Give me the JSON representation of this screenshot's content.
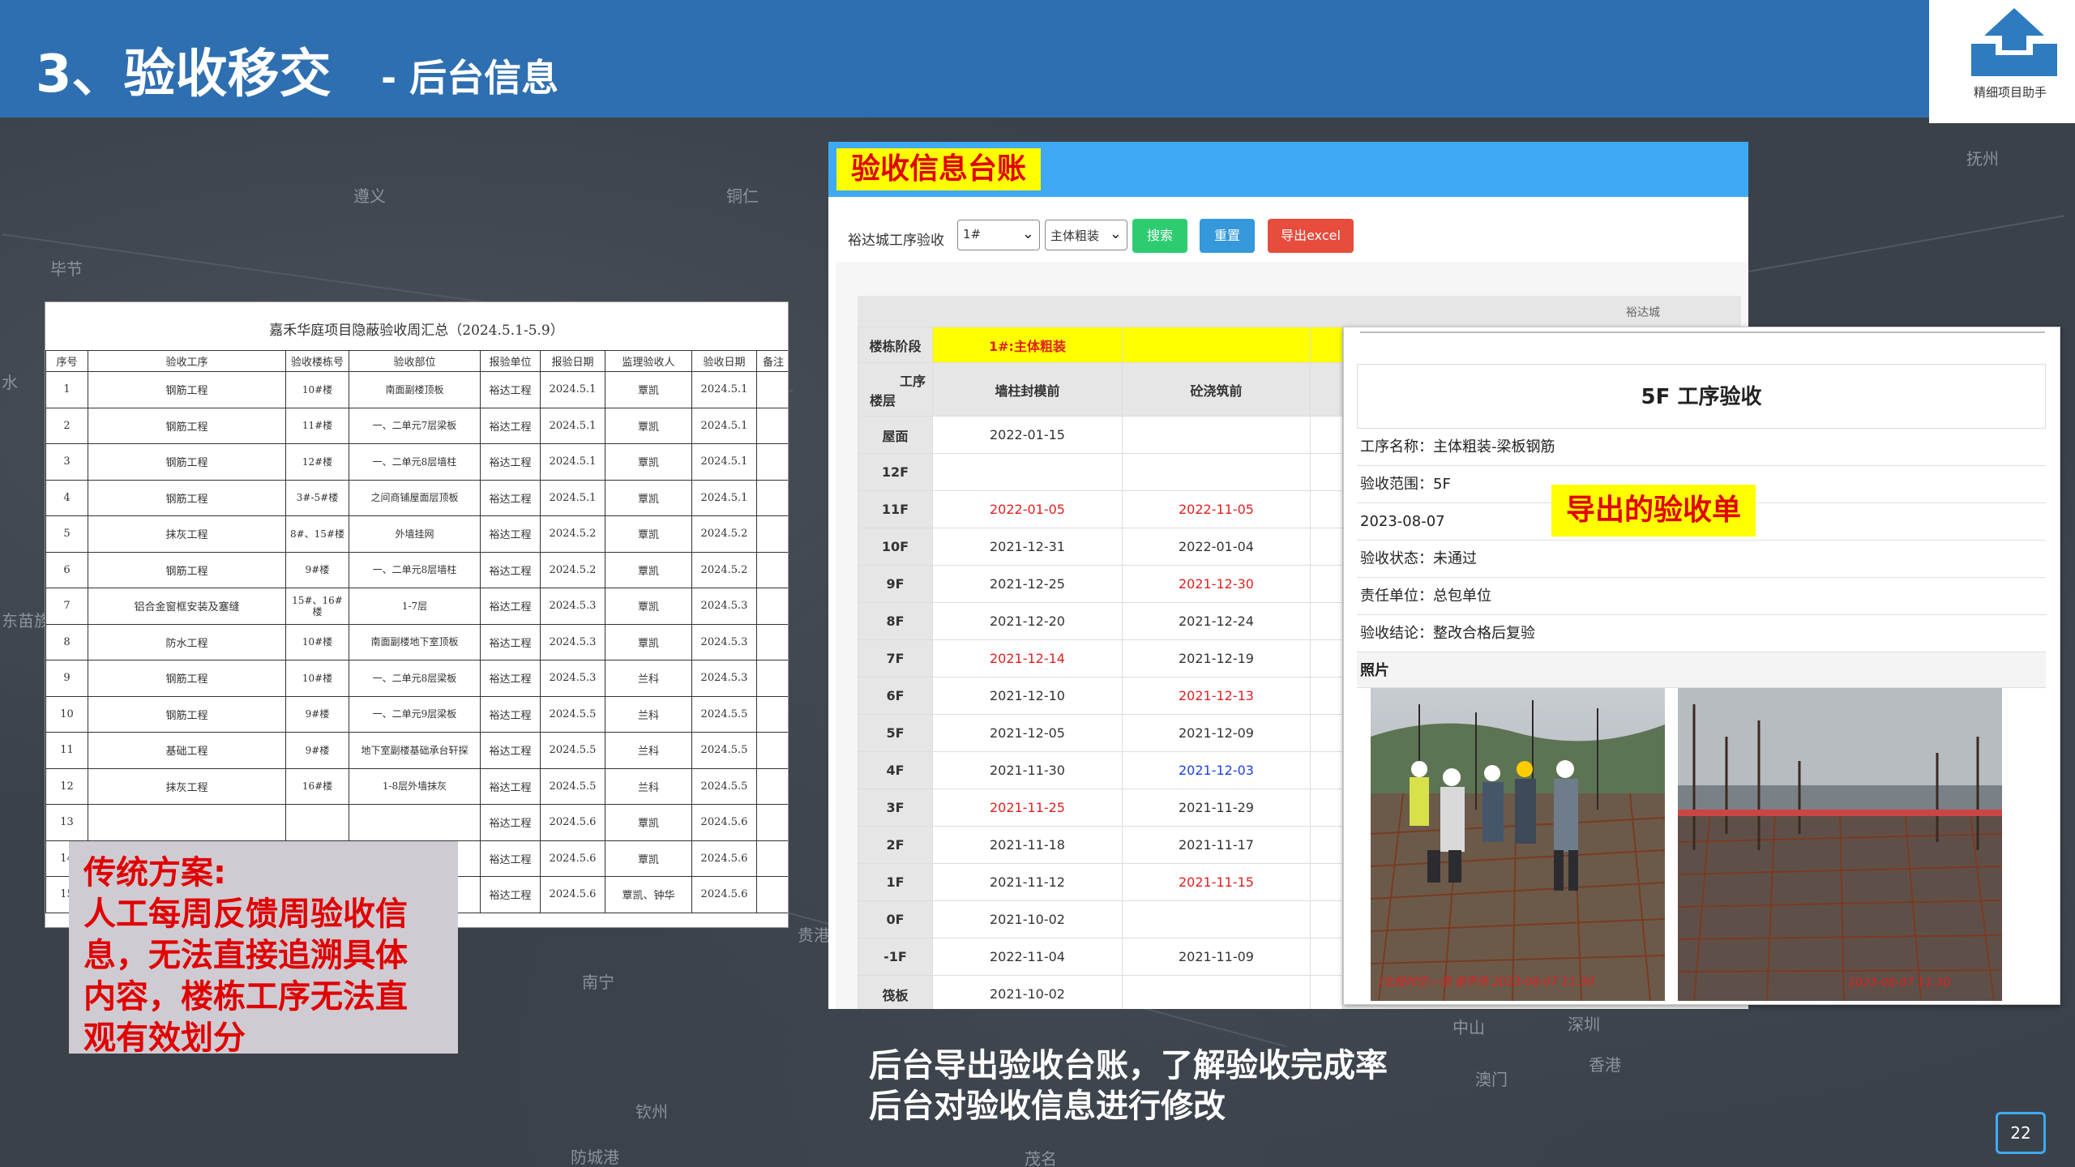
{
  "header": {
    "title": "3、验收移交",
    "subtitle": "- 后台信息",
    "logo_text": "精细项目助手"
  },
  "map_labels": [
    "遵义",
    "铜仁",
    "毕节",
    "抚州",
    "水",
    "东苗族",
    "贵港",
    "南宁",
    "钦州",
    "防城港",
    "茂名",
    "中山",
    "深圳",
    "香港",
    "澳门"
  ],
  "doc": {
    "title": "嘉禾华庭项目隐蔽验收周汇总（2024.5.1-5.9）",
    "headers": [
      "序号",
      "验收工序",
      "验收楼栋号",
      "验收部位",
      "报验单位",
      "报验日期",
      "监理验收人",
      "验收日期",
      "备注"
    ],
    "rows": [
      [
        "1",
        "钢筋工程",
        "10#楼",
        "南面副楼顶板",
        "裕达工程",
        "2024.5.1",
        "覃凯",
        "2024.5.1",
        ""
      ],
      [
        "2",
        "钢筋工程",
        "11#楼",
        "一、二单元7层梁板",
        "裕达工程",
        "2024.5.1",
        "覃凯",
        "2024.5.1",
        ""
      ],
      [
        "3",
        "钢筋工程",
        "12#楼",
        "一、二单元8层墙柱",
        "裕达工程",
        "2024.5.1",
        "覃凯",
        "2024.5.1",
        ""
      ],
      [
        "4",
        "钢筋工程",
        "3#-5#楼",
        "之间商铺屋面层顶板",
        "裕达工程",
        "2024.5.1",
        "覃凯",
        "2024.5.1",
        ""
      ],
      [
        "5",
        "抹灰工程",
        "8#、15#楼",
        "外墙挂网",
        "裕达工程",
        "2024.5.2",
        "覃凯",
        "2024.5.2",
        ""
      ],
      [
        "6",
        "钢筋工程",
        "9#楼",
        "一、二单元8层墙柱",
        "裕达工程",
        "2024.5.2",
        "覃凯",
        "2024.5.2",
        ""
      ],
      [
        "7",
        "铝合金窗框安装及塞缝",
        "15#、16#楼",
        "1-7层",
        "裕达工程",
        "2024.5.3",
        "覃凯",
        "2024.5.3",
        ""
      ],
      [
        "8",
        "防水工程",
        "10#楼",
        "南面副楼地下室顶板",
        "裕达工程",
        "2024.5.3",
        "覃凯",
        "2024.5.3",
        ""
      ],
      [
        "9",
        "钢筋工程",
        "10#楼",
        "一、二单元8层梁板",
        "裕达工程",
        "2024.5.3",
        "兰科",
        "2024.5.3",
        ""
      ],
      [
        "10",
        "钢筋工程",
        "9#楼",
        "一、二单元9层梁板",
        "裕达工程",
        "2024.5.5",
        "兰科",
        "2024.5.5",
        ""
      ],
      [
        "11",
        "基础工程",
        "9#楼",
        "地下室副楼基础承台轩探",
        "裕达工程",
        "2024.5.5",
        "兰科",
        "2024.5.5",
        ""
      ],
      [
        "12",
        "抹灰工程",
        "16#楼",
        "1-8层外墙抹灰",
        "裕达工程",
        "2024.5.5",
        "兰科",
        "2024.5.5",
        ""
      ],
      [
        "13",
        "",
        "",
        "",
        "裕达工程",
        "2024.5.6",
        "覃凯",
        "2024.5.6",
        ""
      ],
      [
        "14",
        "",
        "",
        "",
        "裕达工程",
        "2024.5.6",
        "覃凯",
        "2024.5.6",
        ""
      ],
      [
        "15",
        "",
        "",
        "",
        "裕达工程",
        "2024.5.6",
        "覃凯、钟华",
        "2024.5.6",
        ""
      ]
    ]
  },
  "note": {
    "lines": [
      "传统方案:",
      "人工每周反馈周验收信",
      "息，无法直接追溯具体",
      "内容，楼栋工序无法直",
      "观有效划分"
    ]
  },
  "ledger": {
    "label": "验收信息台账",
    "toolbar": {
      "label": "裕达城工序验收",
      "building": "1#",
      "phase": "主体粗装",
      "search": "搜索",
      "reset": "重置",
      "export": "导出excel"
    },
    "band_text": "裕达城",
    "stage_label": "楼栋阶段",
    "stage_value": "1#:主体粗装",
    "corner_top": "工序",
    "corner_bottom": "楼层",
    "columns": [
      "墙柱封模前",
      "砼浇筑前"
    ],
    "rows": [
      {
        "floor": "屋面",
        "a": "2022-01-15",
        "b": "",
        "ac": "",
        "bc": ""
      },
      {
        "floor": "12F",
        "a": "",
        "b": "",
        "ac": "",
        "bc": ""
      },
      {
        "floor": "11F",
        "a": "2022-01-05",
        "b": "2022-11-05",
        "ac": "red",
        "bc": "red"
      },
      {
        "floor": "10F",
        "a": "2021-12-31",
        "b": "2022-01-04",
        "ac": "",
        "bc": ""
      },
      {
        "floor": "9F",
        "a": "2021-12-25",
        "b": "2021-12-30",
        "ac": "",
        "bc": "red"
      },
      {
        "floor": "8F",
        "a": "2021-12-20",
        "b": "2021-12-24",
        "ac": "",
        "bc": ""
      },
      {
        "floor": "7F",
        "a": "2021-12-14",
        "b": "2021-12-19",
        "ac": "red",
        "bc": ""
      },
      {
        "floor": "6F",
        "a": "2021-12-10",
        "b": "2021-12-13",
        "ac": "",
        "bc": "red"
      },
      {
        "floor": "5F",
        "a": "2021-12-05",
        "b": "2021-12-09",
        "ac": "",
        "bc": ""
      },
      {
        "floor": "4F",
        "a": "2021-11-30",
        "b": "2021-12-03",
        "ac": "",
        "bc": "blue"
      },
      {
        "floor": "3F",
        "a": "2021-11-25",
        "b": "2021-11-29",
        "ac": "red",
        "bc": ""
      },
      {
        "floor": "2F",
        "a": "2021-11-18",
        "b": "2021-11-17",
        "ac": "",
        "bc": ""
      },
      {
        "floor": "1F",
        "a": "2021-11-12",
        "b": "2021-11-15",
        "ac": "",
        "bc": "red"
      },
      {
        "floor": "0F",
        "a": "2021-10-02",
        "b": "",
        "ac": "",
        "bc": ""
      },
      {
        "floor": "-1F",
        "a": "2022-11-04",
        "b": "2021-11-09",
        "ac": "",
        "bc": ""
      },
      {
        "floor": "筏板",
        "a": "2021-10-02",
        "b": "",
        "ac": "",
        "bc": ""
      }
    ]
  },
  "form": {
    "title": "5F 工序验收",
    "name": "工序名称：主体粗装-梁板钢筋",
    "scope": "验收范围：5F",
    "date": "2023-08-07",
    "status": "验收状态：未通过",
    "unit": "责任单位：总包单位",
    "conclusion": "验收结论：整改合格后复验",
    "photos_label": "照片",
    "export_label": "导出的验收单",
    "photo1_stamp": "/北投时空—测 谢平员 2023-08-07 11:30",
    "photo2_stamp": "2023-08-07 11:30"
  },
  "caption": {
    "line1": "后台导出验收台账，了解验收完成率",
    "line2": "后台对验收信息进行修改"
  },
  "page_number": "22",
  "colors": {
    "header_blue": "#2e6fb1",
    "ledger_bar": "#3fa9f5",
    "highlight_yellow": "#ffff00",
    "alert_red": "#e00000",
    "btn_search": "#2ecc71",
    "btn_reset": "#3498db",
    "btn_export": "#e74c3c"
  }
}
